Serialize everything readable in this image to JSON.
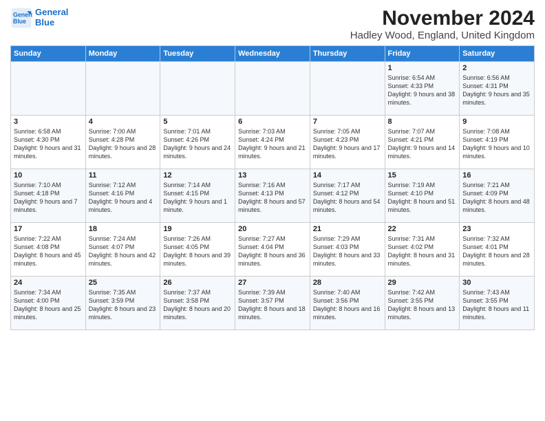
{
  "logo": {
    "line1": "General",
    "line2": "Blue"
  },
  "title": "November 2024",
  "subtitle": "Hadley Wood, England, United Kingdom",
  "days_of_week": [
    "Sunday",
    "Monday",
    "Tuesday",
    "Wednesday",
    "Thursday",
    "Friday",
    "Saturday"
  ],
  "weeks": [
    [
      {
        "date": "",
        "info": ""
      },
      {
        "date": "",
        "info": ""
      },
      {
        "date": "",
        "info": ""
      },
      {
        "date": "",
        "info": ""
      },
      {
        "date": "",
        "info": ""
      },
      {
        "date": "1",
        "info": "Sunrise: 6:54 AM\nSunset: 4:33 PM\nDaylight: 9 hours and 38 minutes."
      },
      {
        "date": "2",
        "info": "Sunrise: 6:56 AM\nSunset: 4:31 PM\nDaylight: 9 hours and 35 minutes."
      }
    ],
    [
      {
        "date": "3",
        "info": "Sunrise: 6:58 AM\nSunset: 4:30 PM\nDaylight: 9 hours and 31 minutes."
      },
      {
        "date": "4",
        "info": "Sunrise: 7:00 AM\nSunset: 4:28 PM\nDaylight: 9 hours and 28 minutes."
      },
      {
        "date": "5",
        "info": "Sunrise: 7:01 AM\nSunset: 4:26 PM\nDaylight: 9 hours and 24 minutes."
      },
      {
        "date": "6",
        "info": "Sunrise: 7:03 AM\nSunset: 4:24 PM\nDaylight: 9 hours and 21 minutes."
      },
      {
        "date": "7",
        "info": "Sunrise: 7:05 AM\nSunset: 4:23 PM\nDaylight: 9 hours and 17 minutes."
      },
      {
        "date": "8",
        "info": "Sunrise: 7:07 AM\nSunset: 4:21 PM\nDaylight: 9 hours and 14 minutes."
      },
      {
        "date": "9",
        "info": "Sunrise: 7:08 AM\nSunset: 4:19 PM\nDaylight: 9 hours and 10 minutes."
      }
    ],
    [
      {
        "date": "10",
        "info": "Sunrise: 7:10 AM\nSunset: 4:18 PM\nDaylight: 9 hours and 7 minutes."
      },
      {
        "date": "11",
        "info": "Sunrise: 7:12 AM\nSunset: 4:16 PM\nDaylight: 9 hours and 4 minutes."
      },
      {
        "date": "12",
        "info": "Sunrise: 7:14 AM\nSunset: 4:15 PM\nDaylight: 9 hours and 1 minute."
      },
      {
        "date": "13",
        "info": "Sunrise: 7:16 AM\nSunset: 4:13 PM\nDaylight: 8 hours and 57 minutes."
      },
      {
        "date": "14",
        "info": "Sunrise: 7:17 AM\nSunset: 4:12 PM\nDaylight: 8 hours and 54 minutes."
      },
      {
        "date": "15",
        "info": "Sunrise: 7:19 AM\nSunset: 4:10 PM\nDaylight: 8 hours and 51 minutes."
      },
      {
        "date": "16",
        "info": "Sunrise: 7:21 AM\nSunset: 4:09 PM\nDaylight: 8 hours and 48 minutes."
      }
    ],
    [
      {
        "date": "17",
        "info": "Sunrise: 7:22 AM\nSunset: 4:08 PM\nDaylight: 8 hours and 45 minutes."
      },
      {
        "date": "18",
        "info": "Sunrise: 7:24 AM\nSunset: 4:07 PM\nDaylight: 8 hours and 42 minutes."
      },
      {
        "date": "19",
        "info": "Sunrise: 7:26 AM\nSunset: 4:05 PM\nDaylight: 8 hours and 39 minutes."
      },
      {
        "date": "20",
        "info": "Sunrise: 7:27 AM\nSunset: 4:04 PM\nDaylight: 8 hours and 36 minutes."
      },
      {
        "date": "21",
        "info": "Sunrise: 7:29 AM\nSunset: 4:03 PM\nDaylight: 8 hours and 33 minutes."
      },
      {
        "date": "22",
        "info": "Sunrise: 7:31 AM\nSunset: 4:02 PM\nDaylight: 8 hours and 31 minutes."
      },
      {
        "date": "23",
        "info": "Sunrise: 7:32 AM\nSunset: 4:01 PM\nDaylight: 8 hours and 28 minutes."
      }
    ],
    [
      {
        "date": "24",
        "info": "Sunrise: 7:34 AM\nSunset: 4:00 PM\nDaylight: 8 hours and 25 minutes."
      },
      {
        "date": "25",
        "info": "Sunrise: 7:35 AM\nSunset: 3:59 PM\nDaylight: 8 hours and 23 minutes."
      },
      {
        "date": "26",
        "info": "Sunrise: 7:37 AM\nSunset: 3:58 PM\nDaylight: 8 hours and 20 minutes."
      },
      {
        "date": "27",
        "info": "Sunrise: 7:39 AM\nSunset: 3:57 PM\nDaylight: 8 hours and 18 minutes."
      },
      {
        "date": "28",
        "info": "Sunrise: 7:40 AM\nSunset: 3:56 PM\nDaylight: 8 hours and 16 minutes."
      },
      {
        "date": "29",
        "info": "Sunrise: 7:42 AM\nSunset: 3:55 PM\nDaylight: 8 hours and 13 minutes."
      },
      {
        "date": "30",
        "info": "Sunrise: 7:43 AM\nSunset: 3:55 PM\nDaylight: 8 hours and 11 minutes."
      }
    ]
  ]
}
